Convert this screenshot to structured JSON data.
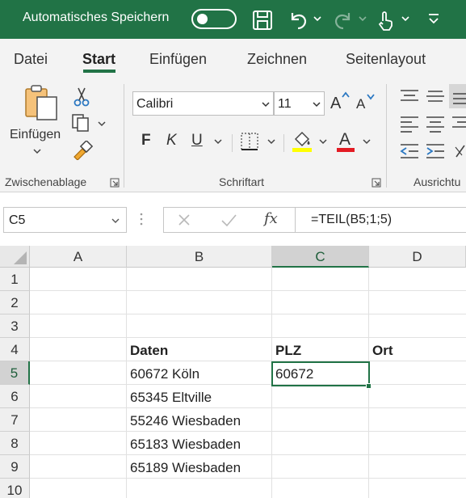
{
  "titlebar": {
    "autosave_label": "Automatisches Speichern",
    "autosave_state": "off",
    "icons": [
      "save-icon",
      "undo-icon",
      "redo-icon",
      "touch-mode-icon",
      "customize-toolbar-icon"
    ],
    "bg_color": "#217346"
  },
  "tabs": [
    {
      "label": "Datei",
      "active": false
    },
    {
      "label": "Start",
      "active": true
    },
    {
      "label": "Einfügen",
      "active": false
    },
    {
      "label": "Zeichnen",
      "active": false
    },
    {
      "label": "Seitenlayout",
      "active": false
    }
  ],
  "ribbon": {
    "clipboard": {
      "paste_label": "Einfügen",
      "group_label": "Zwischenablage"
    },
    "font": {
      "font_name": "Calibri",
      "font_size": "11",
      "bold": "F",
      "italic": "K",
      "underline": "U",
      "group_label": "Schriftart",
      "highlight_color": "#ffff00",
      "font_color": "#e31b23"
    },
    "alignment": {
      "group_label": "Ausrichtu"
    }
  },
  "formula_bar": {
    "name_box": "C5",
    "fx": "fx",
    "formula": "=TEIL(B5;1;5)"
  },
  "grid": {
    "columns": [
      "A",
      "B",
      "C",
      "D"
    ],
    "selected_column": "C",
    "rows": [
      "1",
      "2",
      "3",
      "4",
      "5",
      "6",
      "7",
      "8",
      "9",
      "10"
    ],
    "selected_row": "5",
    "cells": {
      "B4": "Daten",
      "C4": "PLZ",
      "D4": "Ort",
      "B5": "60672 Köln",
      "C5": "60672",
      "B6": "65345 Eltville",
      "B7": "55246 Wiesbaden",
      "B8": "65183 Wiesbaden",
      "B9": "65189 Wiesbaden"
    },
    "active_cell": "C5",
    "accent_color": "#217346"
  }
}
